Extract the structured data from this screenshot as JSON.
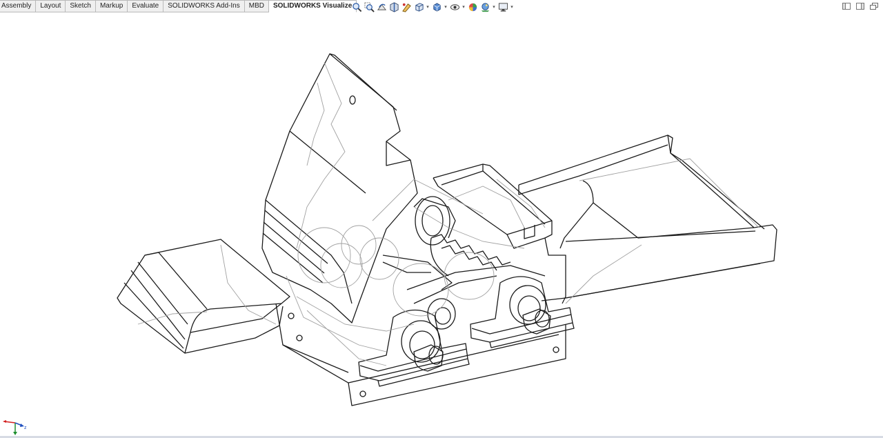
{
  "tabs": [
    {
      "label": "Assembly",
      "active": false
    },
    {
      "label": "Layout",
      "active": false
    },
    {
      "label": "Sketch",
      "active": false
    },
    {
      "label": "Markup",
      "active": false
    },
    {
      "label": "Evaluate",
      "active": false
    },
    {
      "label": "SOLIDWORKS Add-Ins",
      "active": false
    },
    {
      "label": "MBD",
      "active": false
    },
    {
      "label": "SOLIDWORKS Visualize",
      "active": true
    }
  ],
  "toolbar_icons": [
    "zoom-to-fit-icon",
    "zoom-to-area-icon",
    "previous-view-icon",
    "section-view-icon",
    "dynamic-annotation-icon",
    "view-orientation-icon",
    "display-style-icon",
    "hide-show-items-icon",
    "edit-appearance-icon",
    "apply-scene-icon",
    "view-settings-icon"
  ],
  "window_controls": [
    "restore-left-icon",
    "restore-right-icon",
    "maximize-icon"
  ],
  "triad": {
    "x_label": "",
    "y_label": "",
    "z_label": "z"
  },
  "colors": {
    "accent": "#1f5fbf",
    "tab_bg": "#efefef",
    "viewport_bg": "#ffffff",
    "line": "#1a1a1a",
    "hidden_line": "#9a9a9a"
  }
}
